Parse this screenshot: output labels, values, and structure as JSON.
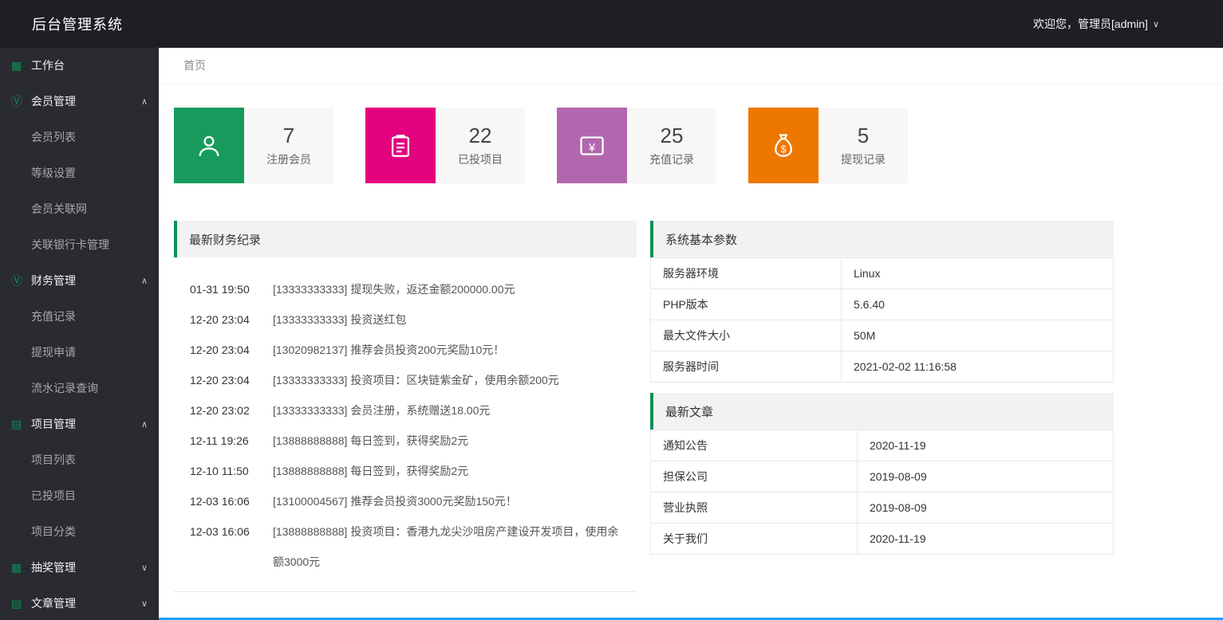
{
  "header": {
    "title": "后台管理系统",
    "welcome": "欢迎您，管理员[admin]"
  },
  "sidebar": {
    "items": [
      {
        "name": "workbench",
        "label": "工作台",
        "icon": "workbench-grid-icon"
      },
      {
        "name": "members",
        "label": "会员管理",
        "icon": "members-icon",
        "expanded": true,
        "children": [
          {
            "name": "member-list",
            "label": "会员列表"
          },
          {
            "name": "level-settings",
            "label": "等级设置"
          },
          {
            "name": "member-network",
            "label": "会员关联网"
          },
          {
            "name": "bank-card-management",
            "label": "关联银行卡管理"
          }
        ]
      },
      {
        "name": "finance",
        "label": "财务管理",
        "icon": "finance-icon",
        "expanded": true,
        "children": [
          {
            "name": "recharge-records",
            "label": "充值记录"
          },
          {
            "name": "withdrawal-requests",
            "label": "提现申请"
          },
          {
            "name": "transaction-query",
            "label": "流水记录查询"
          }
        ]
      },
      {
        "name": "projects",
        "label": "项目管理",
        "icon": "projects-icon",
        "expanded": true,
        "children": [
          {
            "name": "project-list",
            "label": "项目列表"
          },
          {
            "name": "invested-projects",
            "label": "已投项目"
          },
          {
            "name": "project-categories",
            "label": "项目分类"
          }
        ]
      },
      {
        "name": "lottery",
        "label": "抽奖管理",
        "icon": "lottery-icon",
        "expanded": false,
        "children": []
      },
      {
        "name": "articles",
        "label": "文章管理",
        "icon": "articles-icon",
        "expanded": false,
        "children": []
      }
    ]
  },
  "breadcrumb": {
    "home": "首页"
  },
  "stats": [
    {
      "name": "registered-members",
      "value": "7",
      "label": "注册会员",
      "color": "#169b5c",
      "icon": "user-icon"
    },
    {
      "name": "invested-projects",
      "value": "22",
      "label": "已投项目",
      "color": "#e4017e",
      "icon": "clipboard-icon"
    },
    {
      "name": "recharge-records",
      "value": "25",
      "label": "充值记录",
      "color": "#b266ae",
      "icon": "recharge-card-icon"
    },
    {
      "name": "withdrawal-records",
      "value": "5",
      "label": "提现记录",
      "color": "#ee7700",
      "icon": "money-bag-icon"
    }
  ],
  "finance_panel": {
    "title": "最新财务纪录",
    "records": [
      {
        "time": "01-31 19:50",
        "text": "[13333333333] 提现失败，返还金额200000.00元"
      },
      {
        "time": "12-20 23:04",
        "text": "[13333333333] 投资送红包"
      },
      {
        "time": "12-20 23:04",
        "text": "[13020982137] 推荐会员投资200元奖励10元！"
      },
      {
        "time": "12-20 23:04",
        "text": "[13333333333] 投资项目：区块链紫金矿，使用余额200元"
      },
      {
        "time": "12-20 23:02",
        "text": "[13333333333] 会员注册，系统赠送18.00元"
      },
      {
        "time": "12-11 19:26",
        "text": "[13888888888] 每日签到，获得奖励2元"
      },
      {
        "time": "12-10 11:50",
        "text": "[13888888888] 每日签到，获得奖励2元"
      },
      {
        "time": "12-03 16:06",
        "text": "[13100004567] 推荐会员投资3000元奖励150元！"
      },
      {
        "time": "12-03 16:06",
        "text": "[13888888888] 投资项目：香港九龙尖沙咀房产建设开发项目，使用余额3000元"
      }
    ]
  },
  "system_panel": {
    "title": "系统基本参数",
    "rows": [
      {
        "key": "服务器环境",
        "value": "Linux"
      },
      {
        "key": "PHP版本",
        "value": "5.6.40"
      },
      {
        "key": "最大文件大小",
        "value": "50M"
      },
      {
        "key": "服务器时间",
        "value": "2021-02-02 11:16:58"
      }
    ]
  },
  "articles_panel": {
    "title": "最新文章",
    "rows": [
      {
        "key": "通知公告",
        "value": "2020-11-19"
      },
      {
        "key": "担保公司",
        "value": "2019-08-09"
      },
      {
        "key": "营业执照",
        "value": "2019-08-09"
      },
      {
        "key": "关于我们",
        "value": "2020-11-19"
      }
    ]
  },
  "colors": {
    "accent_green": "#0e8f55",
    "footer_blue": "#1e9fff"
  }
}
